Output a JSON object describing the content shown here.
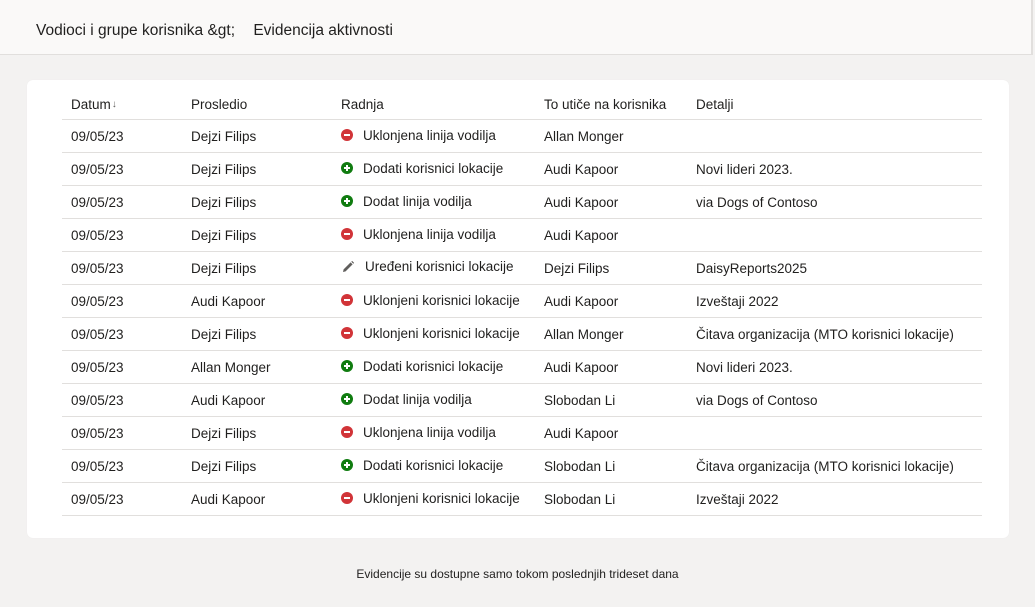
{
  "breadcrumb": {
    "parent": "Vodioci i grupe korisnika &gt;",
    "current": "Evidencija aktivnosti"
  },
  "table": {
    "headers": {
      "date": "Datum",
      "date_sort_icon": "sort-down-arrow-icon",
      "by": "Prosledio",
      "action": "Radnja",
      "affects": "To utiče na korisnika",
      "details": "Detalji"
    },
    "rows": [
      {
        "date": "09/05/23",
        "by": "Dejzi Filips",
        "icon": "remove-icon",
        "action": "Uklonjena linija vodilja",
        "affects": "Allan Monger",
        "details": ""
      },
      {
        "date": "09/05/23",
        "by": "Dejzi Filips",
        "icon": "add-icon",
        "action": "Dodati korisnici lokacije",
        "affects": "Audi Kapoor",
        "details": "Novi lideri 2023."
      },
      {
        "date": "09/05/23",
        "by": "Dejzi Filips",
        "icon": "add-icon",
        "action": "Dodat linija vodilja",
        "affects": "Audi Kapoor",
        "details": "via Dogs of Contoso"
      },
      {
        "date": "09/05/23",
        "by": "Dejzi Filips",
        "icon": "remove-icon",
        "action": "Uklonjena linija vodilja",
        "affects": "Audi Kapoor",
        "details": ""
      },
      {
        "date": "09/05/23",
        "by": "Dejzi Filips",
        "icon": "edit-pencil-icon",
        "action": "Uređeni korisnici lokacije",
        "affects": "Dejzi Filips",
        "details": "DaisyReports2025"
      },
      {
        "date": "09/05/23",
        "by": "Audi Kapoor",
        "icon": "remove-icon",
        "action": "Uklonjeni korisnici lokacije",
        "affects": "Audi Kapoor",
        "details": "Izveštaji 2022"
      },
      {
        "date": "09/05/23",
        "by": "Dejzi Filips",
        "icon": "remove-icon",
        "action": "Uklonjeni korisnici lokacije",
        "affects": "Allan Monger",
        "details": "Čitava organizacija (MTO korisnici lokacije)"
      },
      {
        "date": "09/05/23",
        "by": "Allan Monger",
        "icon": "add-icon",
        "action": "Dodati korisnici lokacije",
        "affects": "Audi Kapoor",
        "details": "Novi lideri 2023."
      },
      {
        "date": "09/05/23",
        "by": "Audi Kapoor",
        "icon": "add-icon",
        "action": "Dodat linija vodilja",
        "affects": "Slobodan Li",
        "details": "via Dogs of Contoso"
      },
      {
        "date": "09/05/23",
        "by": "Dejzi Filips",
        "icon": "remove-icon",
        "action": "Uklonjena linija vodilja",
        "affects": "Audi Kapoor",
        "details": ""
      },
      {
        "date": "09/05/23",
        "by": "Dejzi Filips",
        "icon": "add-icon",
        "action": "Dodati korisnici lokacije",
        "affects": "Slobodan Li",
        "details": "Čitava organizacija (MTO korisnici lokacije)"
      },
      {
        "date": "09/05/23",
        "by": "Audi Kapoor",
        "icon": "remove-icon",
        "action": "Uklonjeni korisnici lokacije",
        "affects": "Slobodan Li",
        "details": "Izveštaji 2022"
      }
    ]
  },
  "footer": {
    "note": "Evidencije su dostupne samo tokom poslednjih trideset dana"
  },
  "colors": {
    "remove": "#d13438",
    "add": "#107c10",
    "edit": "#605e5c",
    "divider": "#e1dfdd",
    "page_bg": "#f3f2f1"
  }
}
